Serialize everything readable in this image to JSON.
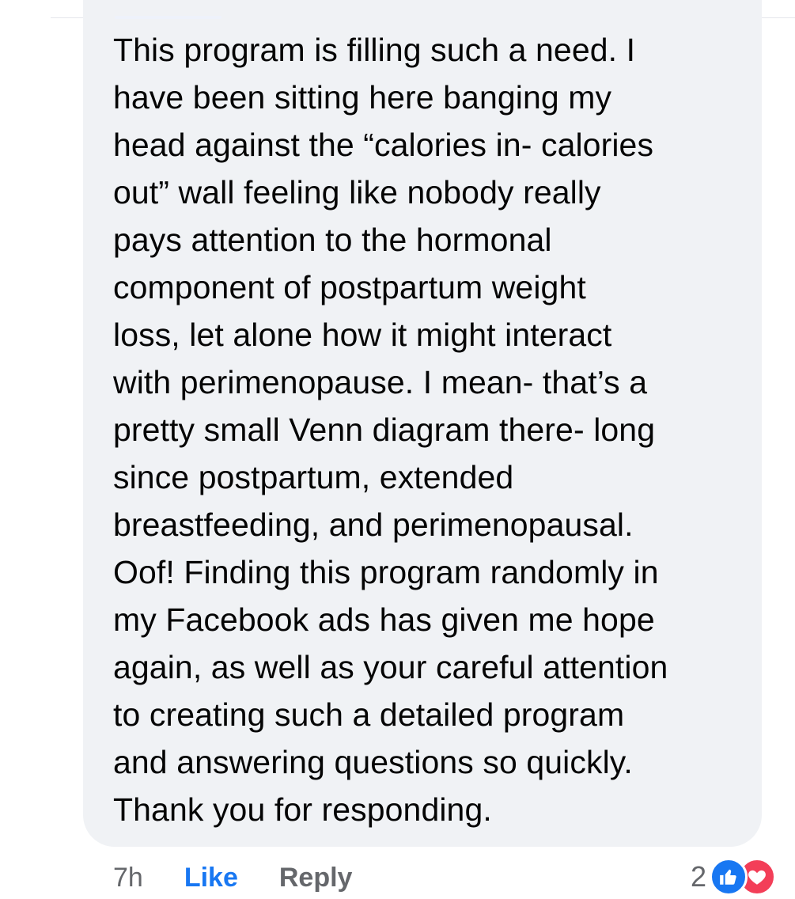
{
  "comment": {
    "text": "This program is filling such a need. I\nhave been sitting here banging my\nhead against the “calories in- calories\nout” wall feeling like nobody really\npays attention to the hormonal\ncomponent of postpartum weight\nloss, let alone how it might interact\nwith perimenopause. I mean- that’s a\npretty small Venn diagram there- long\nsince postpartum, extended\nbreastfeeding, and perimenopausal.\nOof! Finding this program randomly in\nmy Facebook ads has given me hope\nagain, as well as your careful attention\nto creating such a detailed program\nand answering questions so quickly.\nThank you for responding."
  },
  "actions": {
    "timestamp": "7h",
    "like_label": "Like",
    "reply_label": "Reply"
  },
  "reactions": {
    "count": "2",
    "icons": [
      "thumbs-up-icon",
      "heart-icon"
    ]
  },
  "colors": {
    "bubble_bg": "#f0f2f5",
    "like_blue": "#1877f2",
    "love_red": "#f33e58",
    "muted_text": "#65676b"
  }
}
